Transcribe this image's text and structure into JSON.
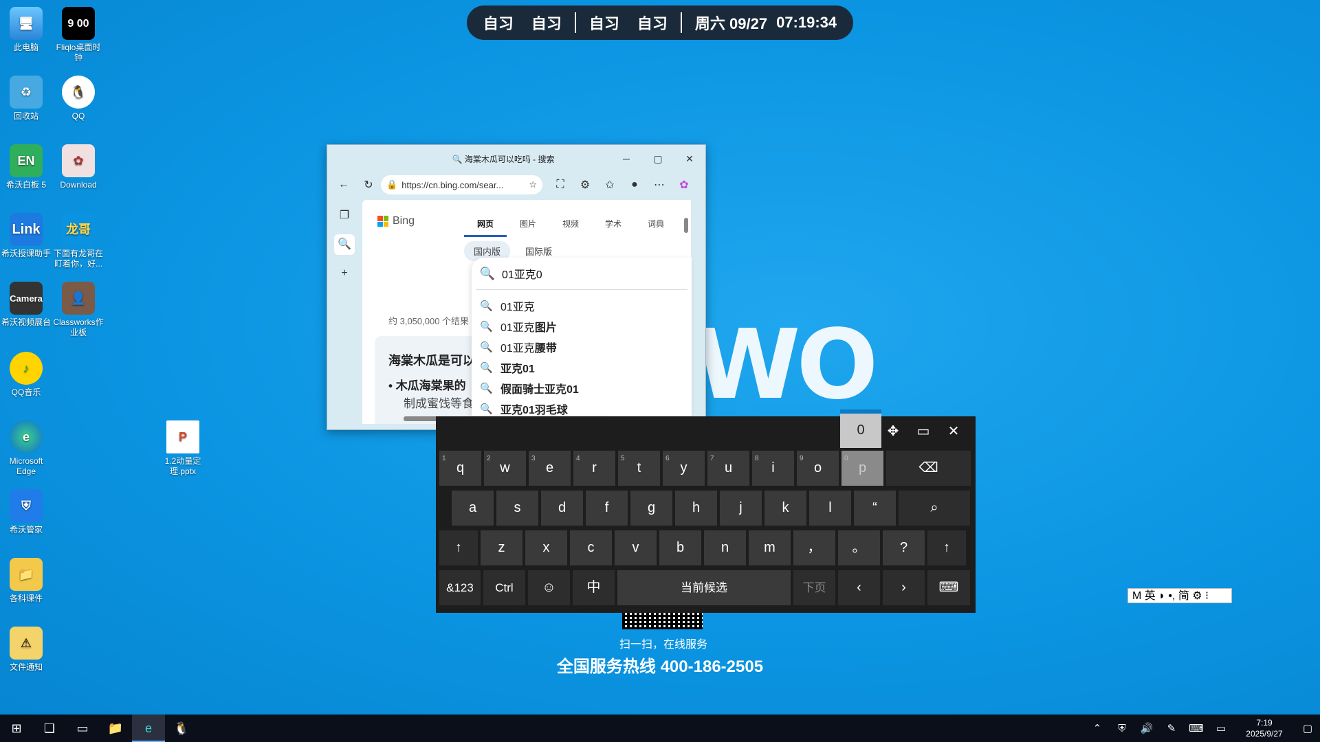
{
  "schedule_bar": {
    "items": [
      "自习",
      "自习",
      "自习",
      "自习"
    ],
    "day": "周六 09/27",
    "time": "07:19:34"
  },
  "desktop_icons": [
    {
      "label": "此电脑",
      "icon": "computer-icon"
    },
    {
      "label": "Fliqlo桌面时钟",
      "icon": "clock-icon",
      "glyph": "9 00"
    },
    {
      "label": "回收站",
      "icon": "recycle-bin-icon"
    },
    {
      "label": "QQ",
      "icon": "qq-penguin-icon"
    },
    {
      "label": "希沃白板 5",
      "icon": "seewo-whiteboard-icon",
      "glyph": "EN"
    },
    {
      "label": "Download",
      "icon": "anime-folder-icon"
    },
    {
      "label": "希沃授课助手",
      "icon": "seewo-link-icon",
      "glyph": "Link"
    },
    {
      "label": "下面有龙哥在盯着你，好...",
      "icon": "peek-image-icon",
      "glyph": "龙哥"
    },
    {
      "label": "希沃视频展台",
      "icon": "camera-icon",
      "glyph": "Camera"
    },
    {
      "label": "Classworks作业板",
      "icon": "portrait-icon"
    },
    {
      "label": "QQ音乐",
      "icon": "qq-music-icon"
    },
    {
      "label": "Microsoft Edge",
      "icon": "edge-icon"
    },
    {
      "label": "1.2动量定理.pptx",
      "icon": "powerpoint-icon",
      "glyph": "P"
    },
    {
      "label": "希沃管家",
      "icon": "shield-icon"
    },
    {
      "label": "各科课件",
      "icon": "folder-icon"
    },
    {
      "label": "文件通知",
      "icon": "warning-folder-icon"
    }
  ],
  "browser": {
    "title": "海棠木瓜可以吃吗 - 搜索",
    "url": "https://cn.bing.com/sear...",
    "bing": "Bing",
    "tabs": [
      "网页",
      "图片",
      "视频",
      "学术",
      "词典"
    ],
    "regions": [
      "国内版",
      "国际版"
    ],
    "result_count": "约 3,050,000 个结果",
    "card_title": "海棠木瓜是可以",
    "card_bullet": "木瓜海棠果的",
    "card_text": "制成蜜饯等食"
  },
  "search": {
    "query": "01亚克0",
    "suggestions": [
      {
        "pre": "01亚克",
        "bold": ""
      },
      {
        "pre": "01亚克",
        "bold": "图片"
      },
      {
        "pre": "01亚克",
        "bold": "腰带"
      },
      {
        "pre": "",
        "bold": "亚克01"
      },
      {
        "pre": "",
        "bold": "假面骑士亚克01"
      },
      {
        "pre": "",
        "bold": "亚克01羽毛球"
      }
    ]
  },
  "keyboard": {
    "candidate": "0",
    "row1": [
      [
        "q",
        "1"
      ],
      [
        "w",
        "2"
      ],
      [
        "e",
        "3"
      ],
      [
        "r",
        "4"
      ],
      [
        "t",
        "5"
      ],
      [
        "y",
        "6"
      ],
      [
        "u",
        "7"
      ],
      [
        "i",
        "8"
      ],
      [
        "o",
        "9"
      ],
      [
        "p",
        "0"
      ]
    ],
    "row2": [
      "a",
      "s",
      "d",
      "f",
      "g",
      "h",
      "j",
      "k",
      "l",
      "“"
    ],
    "row3": [
      "z",
      "x",
      "c",
      "v",
      "b",
      "n",
      "m",
      "，",
      "。",
      "?"
    ],
    "sym": "&123",
    "ctrl": "Ctrl",
    "lang": "中",
    "candidates_label": "当前候选",
    "next_page": "下页"
  },
  "wallpaper": {
    "logo": "WO",
    "scan_text": "扫一扫，在线服务",
    "hotline": "全国服务热线 400-186-2505"
  },
  "ime_bar": "M 英 ◗ •, 简 ⚙ ⁝",
  "taskbar": {
    "time": "7:19",
    "date": "2025/9/27"
  }
}
